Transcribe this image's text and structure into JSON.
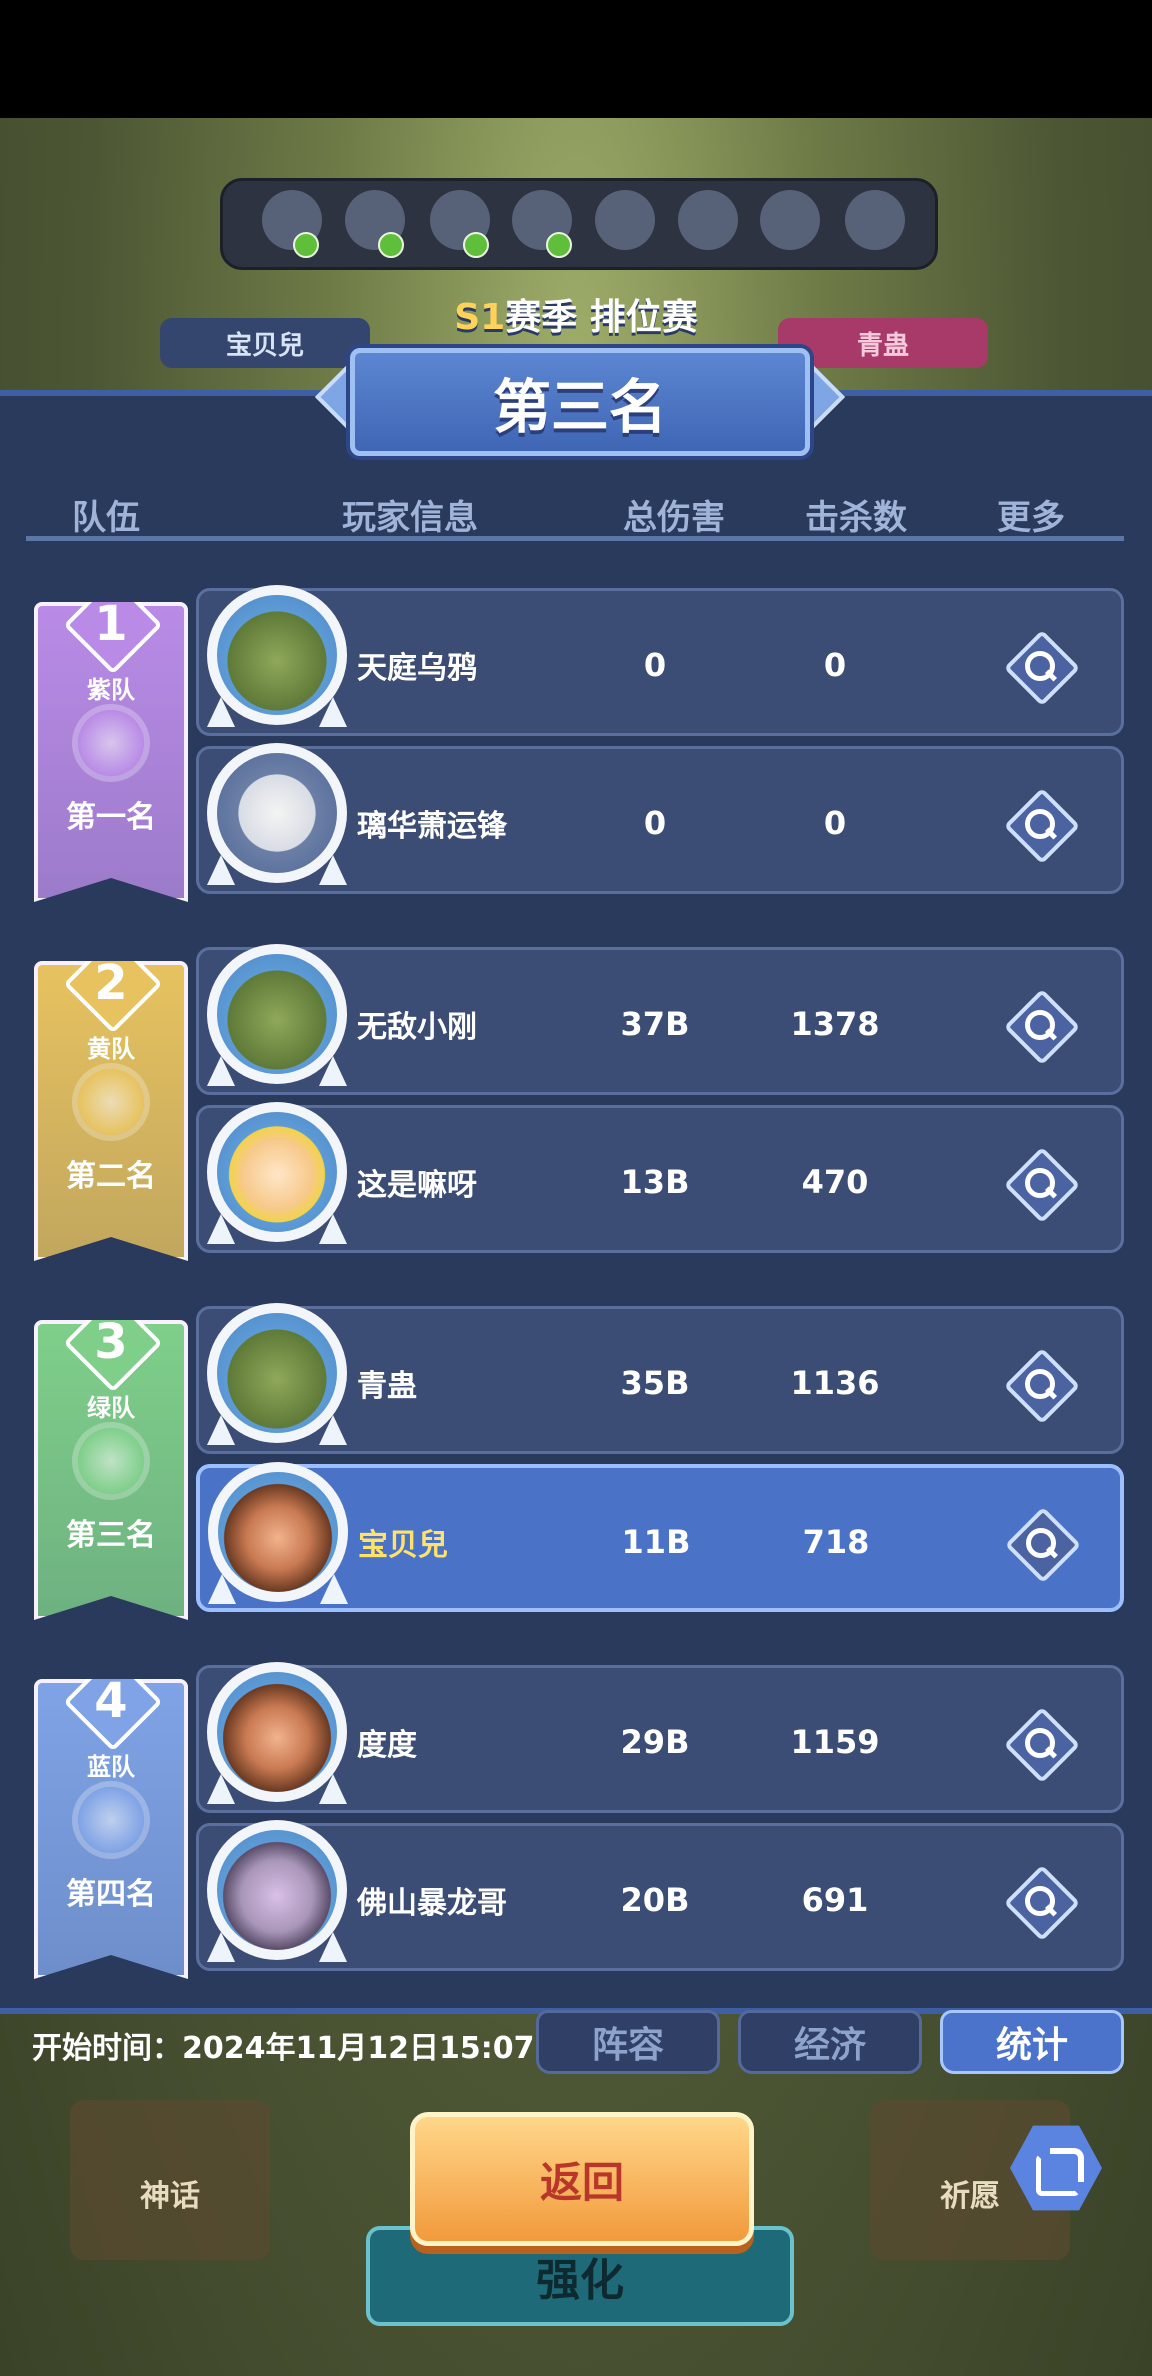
{
  "season": {
    "prefix": "S1",
    "label": "赛季 排位赛"
  },
  "title": "第三名",
  "top_names": {
    "left": "宝贝兒",
    "right": "青蛊"
  },
  "headers": {
    "team": "队伍",
    "player": "玩家信息",
    "damage": "总伤害",
    "kills": "击杀数",
    "more": "更多"
  },
  "teams": [
    {
      "num": "1",
      "name": "紫队",
      "rank": "第一名",
      "color": "#b98be6",
      "players": [
        {
          "name": "天庭乌鸦",
          "damage": "0",
          "kills": "0",
          "avatar": "croc-avatar"
        },
        {
          "name": "璃华萧运锋",
          "damage": "0",
          "kills": "0",
          "avatar": "wizard-avatar"
        }
      ]
    },
    {
      "num": "2",
      "name": "黄队",
      "rank": "第二名",
      "color": "#e7c25f",
      "players": [
        {
          "name": "无敌小刚",
          "damage": "37B",
          "kills": "1378",
          "avatar": "croc-avatar"
        },
        {
          "name": "这是嘛呀",
          "damage": "13B",
          "kills": "470",
          "avatar": "princess-avatar"
        }
      ]
    },
    {
      "num": "3",
      "name": "绿队",
      "rank": "第三名",
      "color": "#7fcf8a",
      "players": [
        {
          "name": "青蛊",
          "damage": "35B",
          "kills": "1136",
          "avatar": "croc-avatar"
        },
        {
          "name": "宝贝兒",
          "damage": "11B",
          "kills": "718",
          "avatar": "brownhair-avatar",
          "highlight": true
        }
      ]
    },
    {
      "num": "4",
      "name": "蓝队",
      "rank": "第四名",
      "color": "#7fa3e6",
      "players": [
        {
          "name": "度度",
          "damage": "29B",
          "kills": "1159",
          "avatar": "brownhair-avatar"
        },
        {
          "name": "佛山暴龙哥",
          "damage": "20B",
          "kills": "691",
          "avatar": "knight-avatar"
        }
      ]
    }
  ],
  "start_time": {
    "label": "开始时间：",
    "value": "2024年11月12日15:07"
  },
  "tabs": [
    {
      "label": "阵容"
    },
    {
      "label": "经济"
    },
    {
      "label": "统计",
      "active": true
    }
  ],
  "back_label": "返回",
  "background_labels": {
    "left": "神话",
    "right": "祈愿",
    "center": "强化"
  },
  "colors": {
    "panel": "#2a3a5c",
    "row": "#3b4d74",
    "highlight_row": "#4a72c6",
    "accent": "#4c73cc",
    "button_orange": "#f29a3c"
  },
  "icons": {
    "more": "magnifier-icon",
    "share": "share-icon"
  }
}
